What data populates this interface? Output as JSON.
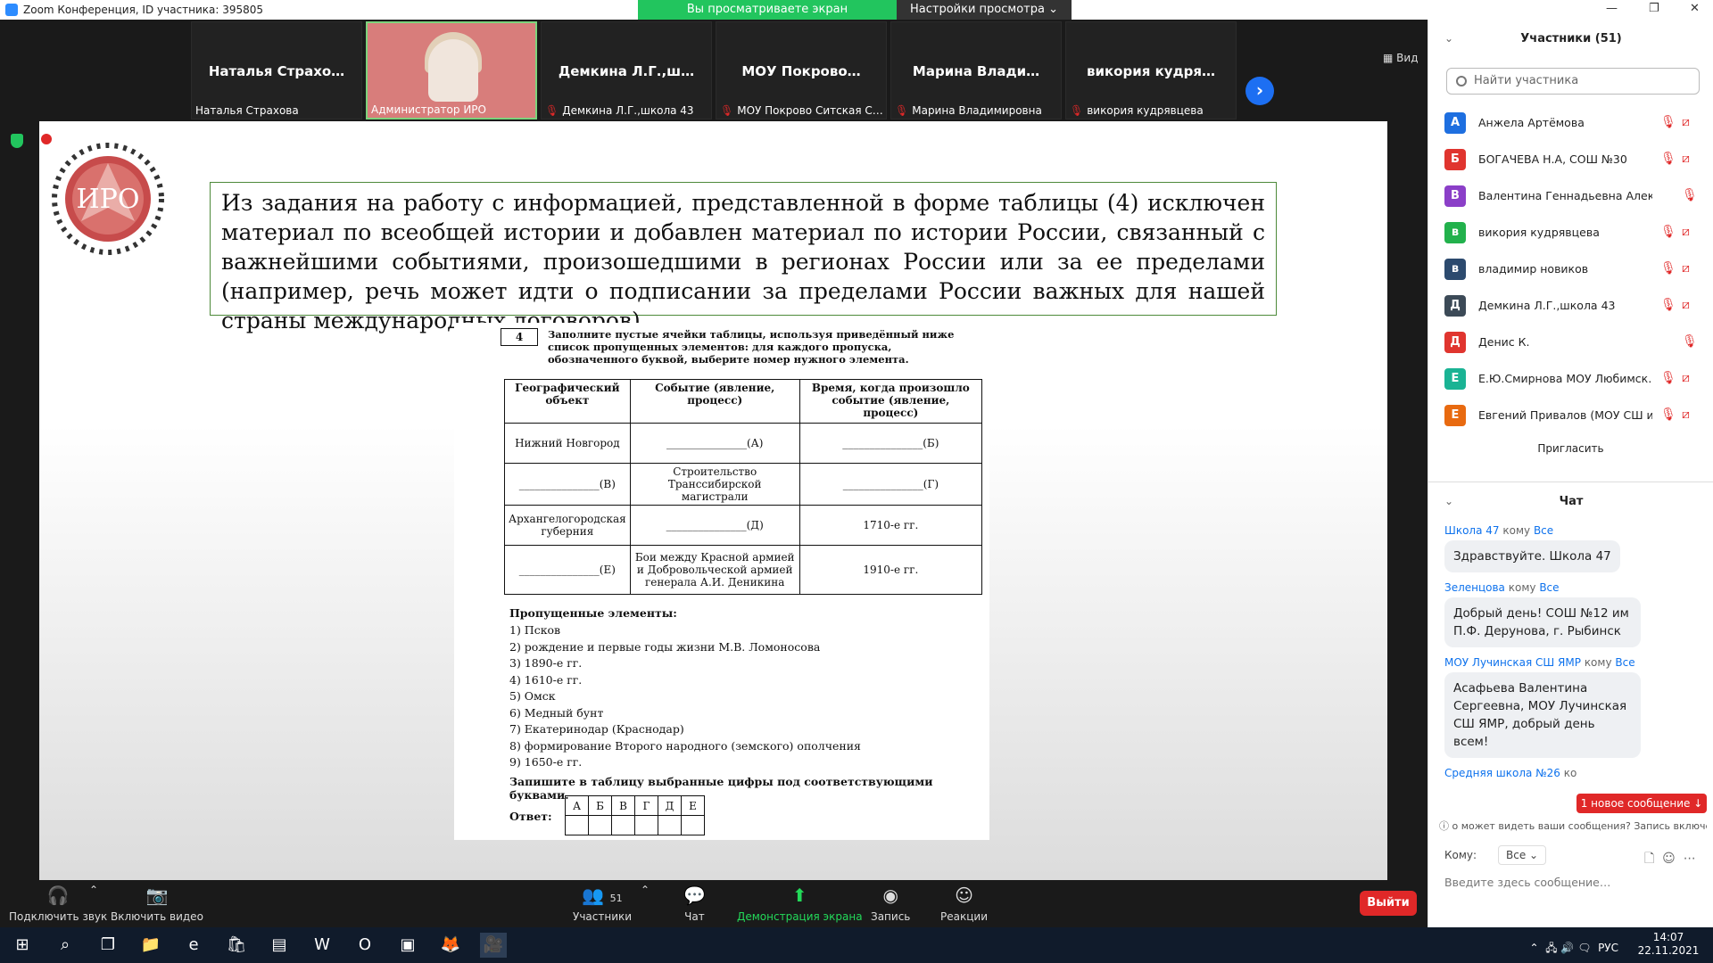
{
  "window": {
    "title": "Zoom Конференция, ID участника: 395805",
    "banner_message": "Вы просматриваете экран Администратор ИРО",
    "banner_button": "Настройки просмотра ⌄",
    "view_label": "Вид"
  },
  "thumbnails": [
    {
      "big_name": "Наталья  Страхо…",
      "label": "Наталья Страхова",
      "muted": false
    },
    {
      "big_name": "",
      "label": "Администратор ИРО",
      "muted": false
    },
    {
      "big_name": "Демкина  Л.Г.,ш…",
      "label": "Демкина Л.Г.,школа 43",
      "muted": true
    },
    {
      "big_name": "МОУ  Покрово…",
      "label": "МОУ Покрово Ситская С…",
      "muted": true
    },
    {
      "big_name": "Марина  Влади…",
      "label": "Марина Владимировна",
      "muted": true
    },
    {
      "big_name": "викория  кудря…",
      "label": "викория кудрявцева",
      "muted": true
    }
  ],
  "logo": {
    "letters": "ИРО"
  },
  "slide": {
    "info_text": "Из задания на работу с информацией, представленной в форме таблицы (4) исключен материал по всеобщей истории и добавлен материал по истории России, связанный с важнейшими событиями, произошедшими в регионах России или за ее пределами (например, речь может идти о подписании за пределами России важных для нашей страны международных договоров)"
  },
  "task": {
    "number": "4",
    "instruction": "Заполните пустые ячейки таблицы, используя приведённый ниже список пропущенных элементов: для каждого пропуска, обозначенного буквой, выберите номер нужного элемента.",
    "headers": [
      "Географический объект",
      "Событие (явление, процесс)",
      "Время, когда произошло событие (явление, процесс)"
    ],
    "rows": [
      [
        "Нижний Новгород",
        "_______________(А)",
        "_______________(Б)"
      ],
      [
        "_______________(В)",
        "Строительство Транссибирской магистрали",
        "_______________(Г)"
      ],
      [
        "Архангелогородская губерния",
        "_______________(Д)",
        "1710-е гг."
      ],
      [
        "_______________(Е)",
        "Бои между Красной армией и Добровольческой армией генерала А.И. Деникина",
        "1910-е гг."
      ]
    ],
    "missing_title": "Пропущенные элементы:",
    "missing_items": [
      "1)  Псков",
      "2)  рождение и первые годы жизни М.В. Ломоносова",
      "3)  1890-е гг.",
      "4)  1610-е гг.",
      "5)  Омск",
      "6)  Медный бунт",
      "7)  Екатеринодар (Краснодар)",
      "8)  формирование Второго народного (земского) ополчения",
      "9)  1650-е гг."
    ],
    "answer_instruction": "Запишите в таблицу выбранные цифры под соответствующими буквами.",
    "answer_label": "Ответ:",
    "answer_letters": [
      "А",
      "Б",
      "В",
      "Г",
      "Д",
      "Е"
    ]
  },
  "participants_panel": {
    "title": "Участники (51)",
    "search_placeholder": "Найти участника",
    "items": [
      {
        "initial": "А",
        "name": "Анжела Артёмова",
        "color": "#1e6fe0",
        "cam_off": true
      },
      {
        "initial": "Б",
        "name": "БОГАЧЕВА Н.А, СОШ №30",
        "color": "#e0352f",
        "cam_off": true
      },
      {
        "initial": "В",
        "name": "Валентина Геннадьевна Алексеева",
        "color": "#8b3fc8",
        "cam_off": false
      },
      {
        "initial": "в",
        "name": "викория кудрявцева",
        "color": "#22b14c",
        "cam_off": true
      },
      {
        "initial": "в",
        "name": "владимир новиков",
        "color": "#2c4a6e",
        "cam_off": true
      },
      {
        "initial": "Д",
        "name": "Демкина Л.Г.,школа 43",
        "color": "#3c4a57",
        "cam_off": true
      },
      {
        "initial": "Д",
        "name": "Денис К.",
        "color": "#e0352f",
        "cam_off": false
      },
      {
        "initial": "Е",
        "name": "Е.Ю.Смирнова МОУ Любимск…",
        "color": "#1ab394",
        "cam_off": true
      },
      {
        "initial": "Е",
        "name": "Евгений Привалов (МОУ СШ и…",
        "color": "#e86a10",
        "cam_off": true
      }
    ],
    "invite_label": "Пригласить"
  },
  "chat_panel": {
    "title": "Чат",
    "messages": [
      {
        "from": "Школа 47",
        "to_word": "кому",
        "to": "Все",
        "text": "Здравствуйте. Школа 47"
      },
      {
        "from": "Зеленцова",
        "to_word": "кому",
        "to": "Все",
        "text": "Добрый день! СОШ №12 им П.Ф. Дерунова, г. Рыбинск"
      },
      {
        "from": "МОУ Лучинская СШ ЯМР",
        "to_word": " кому",
        "to": "Все",
        "text": "Асафьева Валентина Сергеевна, МОУ Лучинская СШ ЯМР, добрый день всем!"
      },
      {
        "from": "Средняя школа №26",
        "to_word": " ко",
        "to": "",
        "text": ""
      }
    ],
    "new_message_badge": "1 новое сообщение ↓",
    "privacy_note": "о может видеть ваши сообщения? Запись включе",
    "to_label": "Кому:",
    "to_value": "Все",
    "input_placeholder": "Введите здесь сообщение…"
  },
  "toolbar": {
    "audio": "Подключить звук",
    "video": "Включить видео",
    "participants": "Участники",
    "participants_count": "51",
    "chat": "Чат",
    "share": "Демонстрация экрана",
    "record": "Запись",
    "reactions": "Реакции",
    "leave": "Выйти"
  },
  "taskbar": {
    "lang": "РУС",
    "time": "14:07",
    "date": "22.11.2021"
  }
}
